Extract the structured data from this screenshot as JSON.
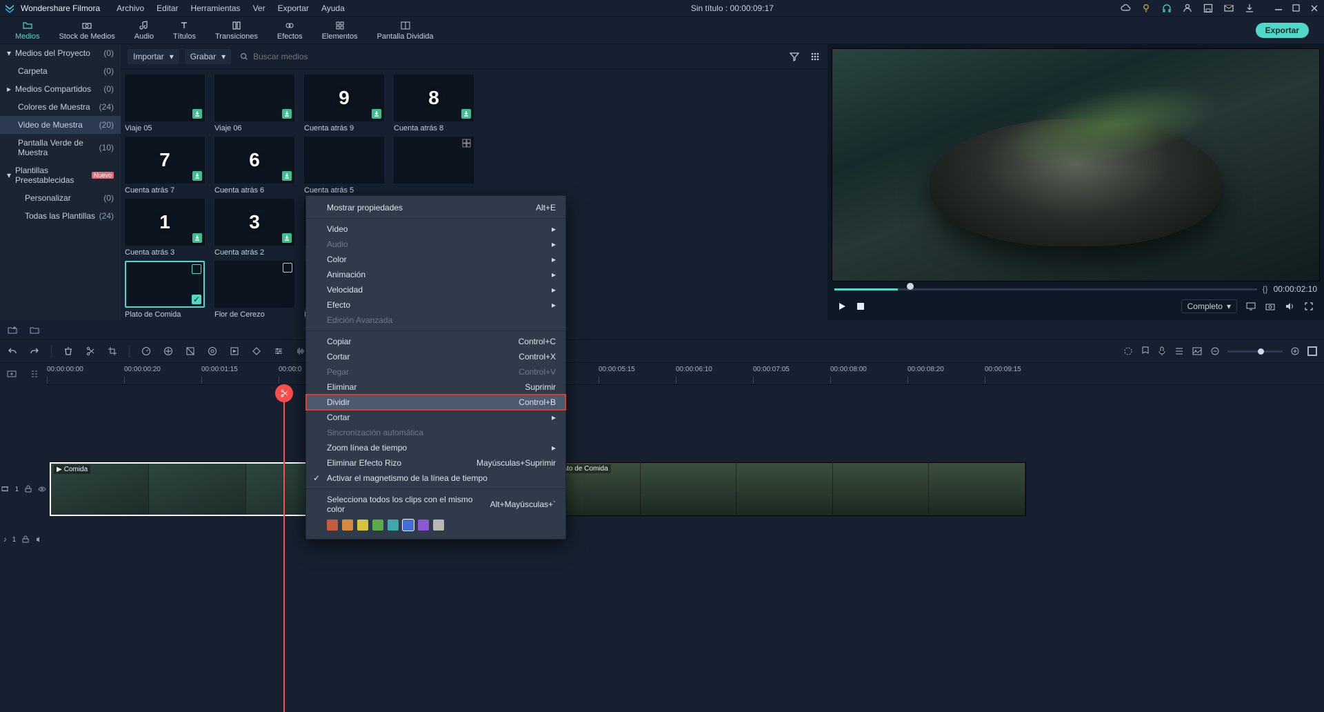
{
  "app": {
    "name": "Wondershare Filmora",
    "titleCenter": "Sin título : 00:00:09:17"
  },
  "menu": [
    "Archivo",
    "Editar",
    "Herramientas",
    "Ver",
    "Exportar",
    "Ayuda"
  ],
  "primaryTabs": [
    {
      "label": "Medios",
      "active": true
    },
    {
      "label": "Stock de Medios"
    },
    {
      "label": "Audio"
    },
    {
      "label": "Títulos"
    },
    {
      "label": "Transiciones"
    },
    {
      "label": "Efectos"
    },
    {
      "label": "Elementos"
    },
    {
      "label": "Pantalla Dividida"
    }
  ],
  "exportBtn": "Exportar",
  "sidebar": [
    {
      "label": "Medios del Proyecto",
      "count": "(0)",
      "expand": true
    },
    {
      "label": "Carpeta",
      "count": "(0)",
      "sub": true
    },
    {
      "label": "Medios Compartidos",
      "count": "(0)",
      "expand": true
    },
    {
      "label": "Colores de Muestra",
      "count": "(24)",
      "sub": true
    },
    {
      "label": "Video de Muestra",
      "count": "(20)",
      "sub": true,
      "active": true
    },
    {
      "label": "Pantalla Verde de Muestra",
      "count": "(10)",
      "sub": true
    },
    {
      "label": "Plantillas Preestablecidas",
      "count": "",
      "expand": true,
      "badge": "Nuevo"
    },
    {
      "label": "Personalizar",
      "count": "(0)",
      "sub": true
    },
    {
      "label": "Todas las Plantillas",
      "count": "(24)",
      "sub": true
    }
  ],
  "mediaToolbar": {
    "import": "Importar",
    "record": "Grabar",
    "searchPlaceholder": "Buscar medios"
  },
  "mediaItems": [
    [
      {
        "cap": "Viaje 05",
        "cls": "trip1",
        "dl": true
      },
      {
        "cap": "Viaje 06",
        "cls": "trip2",
        "dl": true
      },
      {
        "cap": "Cuenta atrás 9",
        "cls": "cd-glow",
        "num": "9",
        "dl": true
      },
      {
        "cap": "Cuenta atrás 8",
        "cls": "cd-purple",
        "num": "8",
        "dl": true
      }
    ],
    [
      {
        "cap": "Cuenta atrás 7",
        "cls": "cd-blue",
        "num": "7",
        "dl": true
      },
      {
        "cap": "Cuenta atrás 6",
        "cls": "cd-glow",
        "num": "6",
        "dl": true
      },
      {
        "cap": "Cuenta atrás 5",
        "cls": "cd-bw",
        "dl": false,
        "cut": true
      },
      {
        "cap": "",
        "cls": "cd-white",
        "dl": false,
        "cut": true,
        "corner": true
      }
    ],
    [
      {
        "cap": "Cuenta atrás 3",
        "cls": "cd-red",
        "num": "1",
        "dl": true
      },
      {
        "cap": "Cuenta atrás 2",
        "cls": "cd-film",
        "num": "3",
        "dl": true
      },
      {
        "cap": "",
        "cls": "cd-glitch",
        "cut": true
      }
    ],
    [
      {
        "cap": "Plato de Comida",
        "cls": "food",
        "sel": true
      },
      {
        "cap": "Flor de Cerezo",
        "cls": "flowers",
        "cam": true
      },
      {
        "cap": "Is",
        "cls": "cd-bw",
        "cut": true
      }
    ]
  ],
  "preview": {
    "timecode": "00:00:02:10",
    "quality": "Completo"
  },
  "timeline": {
    "ticks": [
      "00:00:00:00",
      "00:00:00:20",
      "00:00:01:15",
      "00:00:0",
      "00:00:05:15",
      "00:00:06:10",
      "00:00:07:05",
      "00:00:08:00",
      "00:00:08:20",
      "00:00:09:15"
    ],
    "tickPos": [
      0,
      112,
      224,
      336,
      800,
      912,
      1024,
      1136,
      1248,
      1360
    ],
    "clip1": {
      "label": "Comida"
    },
    "clip2": {
      "label": "Plato de Comida"
    },
    "trackV": "1",
    "trackA": "1"
  },
  "context": {
    "items": [
      {
        "label": "Mostrar propiedades",
        "short": "Alt+E"
      },
      {
        "sep": true
      },
      {
        "label": "Video",
        "sub": true
      },
      {
        "label": "Audio",
        "sub": true,
        "disabled": true
      },
      {
        "label": "Color",
        "sub": true
      },
      {
        "label": "Animación",
        "sub": true
      },
      {
        "label": "Velocidad",
        "sub": true
      },
      {
        "label": "Efecto",
        "sub": true
      },
      {
        "label": "Edición Avanzada",
        "disabled": true
      },
      {
        "sep": true
      },
      {
        "label": "Copiar",
        "short": "Control+C"
      },
      {
        "label": "Cortar",
        "short": "Control+X"
      },
      {
        "label": "Pegar",
        "short": "Control+V",
        "disabled": true
      },
      {
        "label": "Eliminar",
        "short": "Suprimir"
      },
      {
        "label": "Dividir",
        "short": "Control+B",
        "hot": true,
        "hl": true
      },
      {
        "label": "Cortar",
        "sub": true
      },
      {
        "label": "Sincronización automática",
        "disabled": true
      },
      {
        "label": "Zoom línea de tiempo",
        "sub": true
      },
      {
        "label": "Eliminar Efecto Rizo",
        "short": "Mayúsculas+Suprimir"
      },
      {
        "label": "Activar el magnetismo de la línea de tiempo",
        "check": true
      },
      {
        "sep": true
      },
      {
        "label": "Selecciona todos los clips con el mismo color",
        "short": "Alt+Mayúsculas+`"
      }
    ],
    "swatches": [
      "#c65b3f",
      "#d68a3c",
      "#d6c33c",
      "#5cab4a",
      "#3fa8a8",
      "#3f6fd6",
      "#8a5ad6",
      "#b8b8b8"
    ]
  }
}
